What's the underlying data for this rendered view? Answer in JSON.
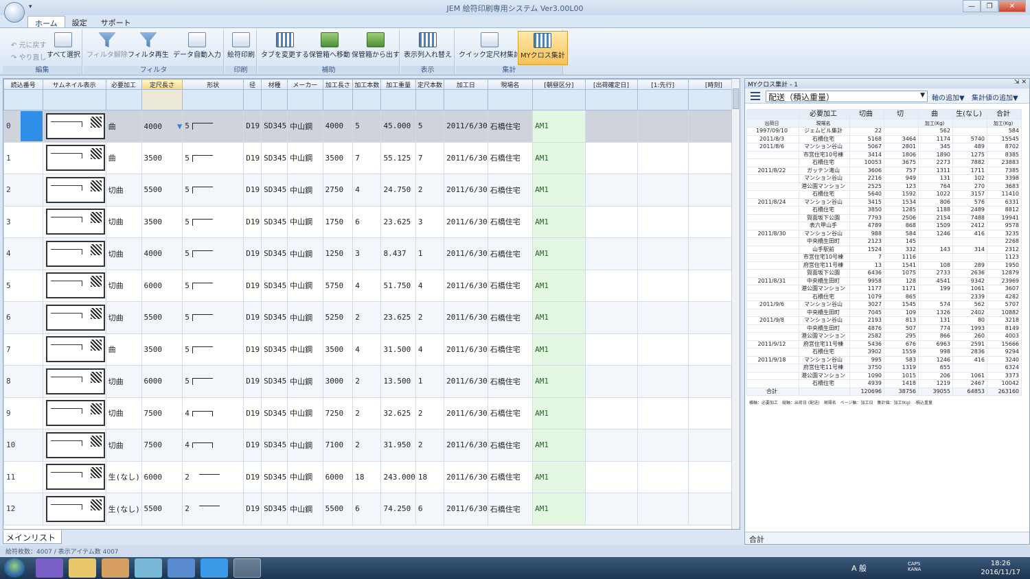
{
  "window": {
    "title": "JEM 絵符印刷専用システム Ver3.00L00",
    "qat": "▾"
  },
  "tabs": [
    "ホーム",
    "設定",
    "サポート"
  ],
  "ribbon": {
    "undo": "元に戻す",
    "redo": "やり直し",
    "select_all": "すべて選択",
    "group_edit": "編集",
    "filter_clear": "フィルタ解除",
    "filter_replay": "フィルタ再生",
    "auto_input": "データ自動入力",
    "group_filter": "フィルタ",
    "print": "絵符印刷",
    "group_print": "印刷",
    "change_tab": "タブを変更する",
    "move_storage": "保管箱へ移動",
    "take_storage": "保管箱から出す",
    "group_aux": "補助",
    "column_swap": "表示列入れ替え",
    "group_view": "表示",
    "quick_total": "クイック定尺材集計",
    "my_cross": "MYクロス集計",
    "group_total": "集計"
  },
  "grid": {
    "headers": [
      "読込番号",
      "サムネイル表示",
      "必要加工",
      "定尺長さ",
      "形状",
      "径",
      "材種",
      "メーカー",
      "加工長さ",
      "加工本数",
      "加工重量",
      "定尺本数",
      "加工日",
      "現場名",
      "[朝昼区分]",
      "[出荷確定日]",
      "[1:先行]",
      "[時刻]"
    ],
    "rows": [
      [
        "0",
        "曲",
        "4000",
        "5",
        "D19",
        "SD345",
        "中山鋼",
        "4000",
        "5",
        "45.000",
        "5",
        "2011/6/30",
        "石橋住宅",
        "AM1"
      ],
      [
        "1",
        "曲",
        "3500",
        "5",
        "D19",
        "SD345",
        "中山鋼",
        "3500",
        "7",
        "55.125",
        "7",
        "2011/6/30",
        "石橋住宅",
        "AM1"
      ],
      [
        "2",
        "切曲",
        "5500",
        "5",
        "D19",
        "SD345",
        "中山鋼",
        "2750",
        "4",
        "24.750",
        "2",
        "2011/6/30",
        "石橋住宅",
        "AM1"
      ],
      [
        "3",
        "切曲",
        "3500",
        "5",
        "D19",
        "SD345",
        "中山鋼",
        "1750",
        "6",
        "23.625",
        "3",
        "2011/6/30",
        "石橋住宅",
        "AM1"
      ],
      [
        "4",
        "切曲",
        "4000",
        "5",
        "D19",
        "SD345",
        "中山鋼",
        "1250",
        "3",
        "8.437",
        "1",
        "2011/6/30",
        "石橋住宅",
        "AM1"
      ],
      [
        "5",
        "切曲",
        "6000",
        "5",
        "D19",
        "SD345",
        "中山鋼",
        "5750",
        "4",
        "51.750",
        "4",
        "2011/6/30",
        "石橋住宅",
        "AM1"
      ],
      [
        "6",
        "切曲",
        "5500",
        "5",
        "D19",
        "SD345",
        "中山鋼",
        "5250",
        "2",
        "23.625",
        "2",
        "2011/6/30",
        "石橋住宅",
        "AM1"
      ],
      [
        "7",
        "曲",
        "3500",
        "5",
        "D19",
        "SD345",
        "中山鋼",
        "3500",
        "4",
        "31.500",
        "4",
        "2011/6/30",
        "石橋住宅",
        "AM1"
      ],
      [
        "8",
        "切曲",
        "6000",
        "5",
        "D19",
        "SD345",
        "中山鋼",
        "3000",
        "2",
        "13.500",
        "1",
        "2011/6/30",
        "石橋住宅",
        "AM1"
      ],
      [
        "9",
        "切曲",
        "7500",
        "4",
        "D19",
        "SD345",
        "中山鋼",
        "7250",
        "2",
        "32.625",
        "2",
        "2011/6/30",
        "石橋住宅",
        "AM1"
      ],
      [
        "10",
        "切曲",
        "7500",
        "4",
        "D19",
        "SD345",
        "中山鋼",
        "7100",
        "2",
        "31.950",
        "2",
        "2011/6/30",
        "石橋住宅",
        "AM1"
      ],
      [
        "11",
        "生(なし)",
        "6000",
        "2",
        "D19",
        "SD345",
        "中山鋼",
        "6000",
        "18",
        "243.000",
        "18",
        "2011/6/30",
        "石橋住宅",
        "AM1"
      ],
      [
        "12",
        "生(なし)",
        "5500",
        "2",
        "D19",
        "SD345",
        "中山鋼",
        "5500",
        "6",
        "74.250",
        "6",
        "2011/6/30",
        "石橋住宅",
        "AM1"
      ]
    ]
  },
  "bottom_tab": "メインリスト",
  "status": "絵符枚数：4007 / 表示アイテム数 4007",
  "side": {
    "title": "MYクロス集計 - 1",
    "combo": "配送（積込重量）",
    "add_axis": "軸の追加▼",
    "add_value": "集計値の追加▼",
    "col_header_label": "必要加工",
    "columns": [
      "切曲",
      "切",
      "曲",
      "生(なし)",
      "合計"
    ],
    "date_hdr": "出荷日",
    "site_hdr": "現場名",
    "unit": "加工(Kg)",
    "rows": [
      [
        "1997/09/10",
        "ジェムビル集計",
        "22",
        "",
        "562",
        "",
        "584"
      ],
      [
        "2011/8/3",
        "石橋住宅",
        "5168",
        "3464",
        "1174",
        "5740",
        "15545"
      ],
      [
        "2011/8/6",
        "マンション谷山",
        "5067",
        "2801",
        "345",
        "489",
        "8702"
      ],
      [
        "",
        "市営住宅10号棟",
        "3414",
        "1806",
        "1890",
        "1275",
        "8385"
      ],
      [
        "",
        "石橋住宅",
        "10053",
        "3675",
        "2273",
        "7882",
        "23883"
      ],
      [
        "2011/8/22",
        "ガッテン滝山",
        "3606",
        "757",
        "1311",
        "1711",
        "7385"
      ],
      [
        "",
        "マンション谷山",
        "2216",
        "949",
        "131",
        "102",
        "3398"
      ],
      [
        "",
        "港公園マンション",
        "2525",
        "123",
        "764",
        "270",
        "3683"
      ],
      [
        "",
        "石橋住宅",
        "5640",
        "1592",
        "1022",
        "3157",
        "11410"
      ],
      [
        "2011/8/24",
        "マンション谷山",
        "3415",
        "1534",
        "806",
        "576",
        "6331"
      ],
      [
        "",
        "石橋住宅",
        "3850",
        "1285",
        "1188",
        "2489",
        "8812"
      ],
      [
        "",
        "賀面坂下公園",
        "7793",
        "2506",
        "2154",
        "7488",
        "19941"
      ],
      [
        "",
        "表六甲山手",
        "4789",
        "868",
        "1509",
        "2412",
        "9578"
      ],
      [
        "2011/8/30",
        "マンション谷山",
        "988",
        "584",
        "1246",
        "416",
        "3235"
      ],
      [
        "",
        "中央橋生田町",
        "2123",
        "145",
        "",
        "",
        "2268"
      ],
      [
        "",
        "山手駅前",
        "1524",
        "332",
        "143",
        "314",
        "2312"
      ],
      [
        "",
        "市営住宅10号棟",
        "7",
        "1116",
        "",
        "",
        "1123"
      ],
      [
        "",
        "府営住宅11号棟",
        "13",
        "1541",
        "108",
        "289",
        "1950"
      ],
      [
        "",
        "賀面坂下公園",
        "6436",
        "1075",
        "2733",
        "2636",
        "12879"
      ],
      [
        "2011/8/31",
        "中央橋生田町",
        "9958",
        "128",
        "4541",
        "9342",
        "23969"
      ],
      [
        "",
        "港公園マンション",
        "1177",
        "1171",
        "199",
        "1061",
        "3607"
      ],
      [
        "",
        "石橋住宅",
        "1079",
        "865",
        "",
        "2339",
        "4282"
      ],
      [
        "2011/9/6",
        "マンション谷山",
        "3027",
        "1545",
        "574",
        "562",
        "5707"
      ],
      [
        "",
        "中央橋生田町",
        "7045",
        "109",
        "1326",
        "2402",
        "10882"
      ],
      [
        "2011/9/8",
        "マンション谷山",
        "2193",
        "813",
        "131",
        "80",
        "3218"
      ],
      [
        "",
        "中央橋生田町",
        "4876",
        "507",
        "774",
        "1993",
        "8149"
      ],
      [
        "",
        "港公園マンション",
        "2582",
        "295",
        "866",
        "260",
        "4003"
      ],
      [
        "2011/9/12",
        "府営住宅11号棟",
        "5436",
        "676",
        "6963",
        "2591",
        "15666"
      ],
      [
        "",
        "石橋住宅",
        "3902",
        "1559",
        "998",
        "2836",
        "9294"
      ],
      [
        "2011/9/18",
        "マンション谷山",
        "995",
        "583",
        "1246",
        "416",
        "3240"
      ],
      [
        "",
        "府営住宅11号棟",
        "3750",
        "1319",
        "655",
        "",
        "6324"
      ],
      [
        "",
        "港公園マンション",
        "1090",
        "1015",
        "206",
        "1061",
        "3373"
      ],
      [
        "",
        "石橋住宅",
        "4939",
        "1418",
        "1219",
        "2467",
        "10042"
      ]
    ],
    "total_label": "合計",
    "totals": [
      "120696",
      "38756",
      "39055",
      "64853",
      "263160"
    ],
    "legend": "横軸：必要加工　縦軸：出荷日 (配送)　現場名　ページ軸：加工日　集計値：加工(Kg)　-積込重量",
    "bottom": "合計"
  },
  "taskbar": {
    "ime": "A 般",
    "caps": "CAPS KANA",
    "time": "18:26",
    "date": "2016/11/17"
  }
}
